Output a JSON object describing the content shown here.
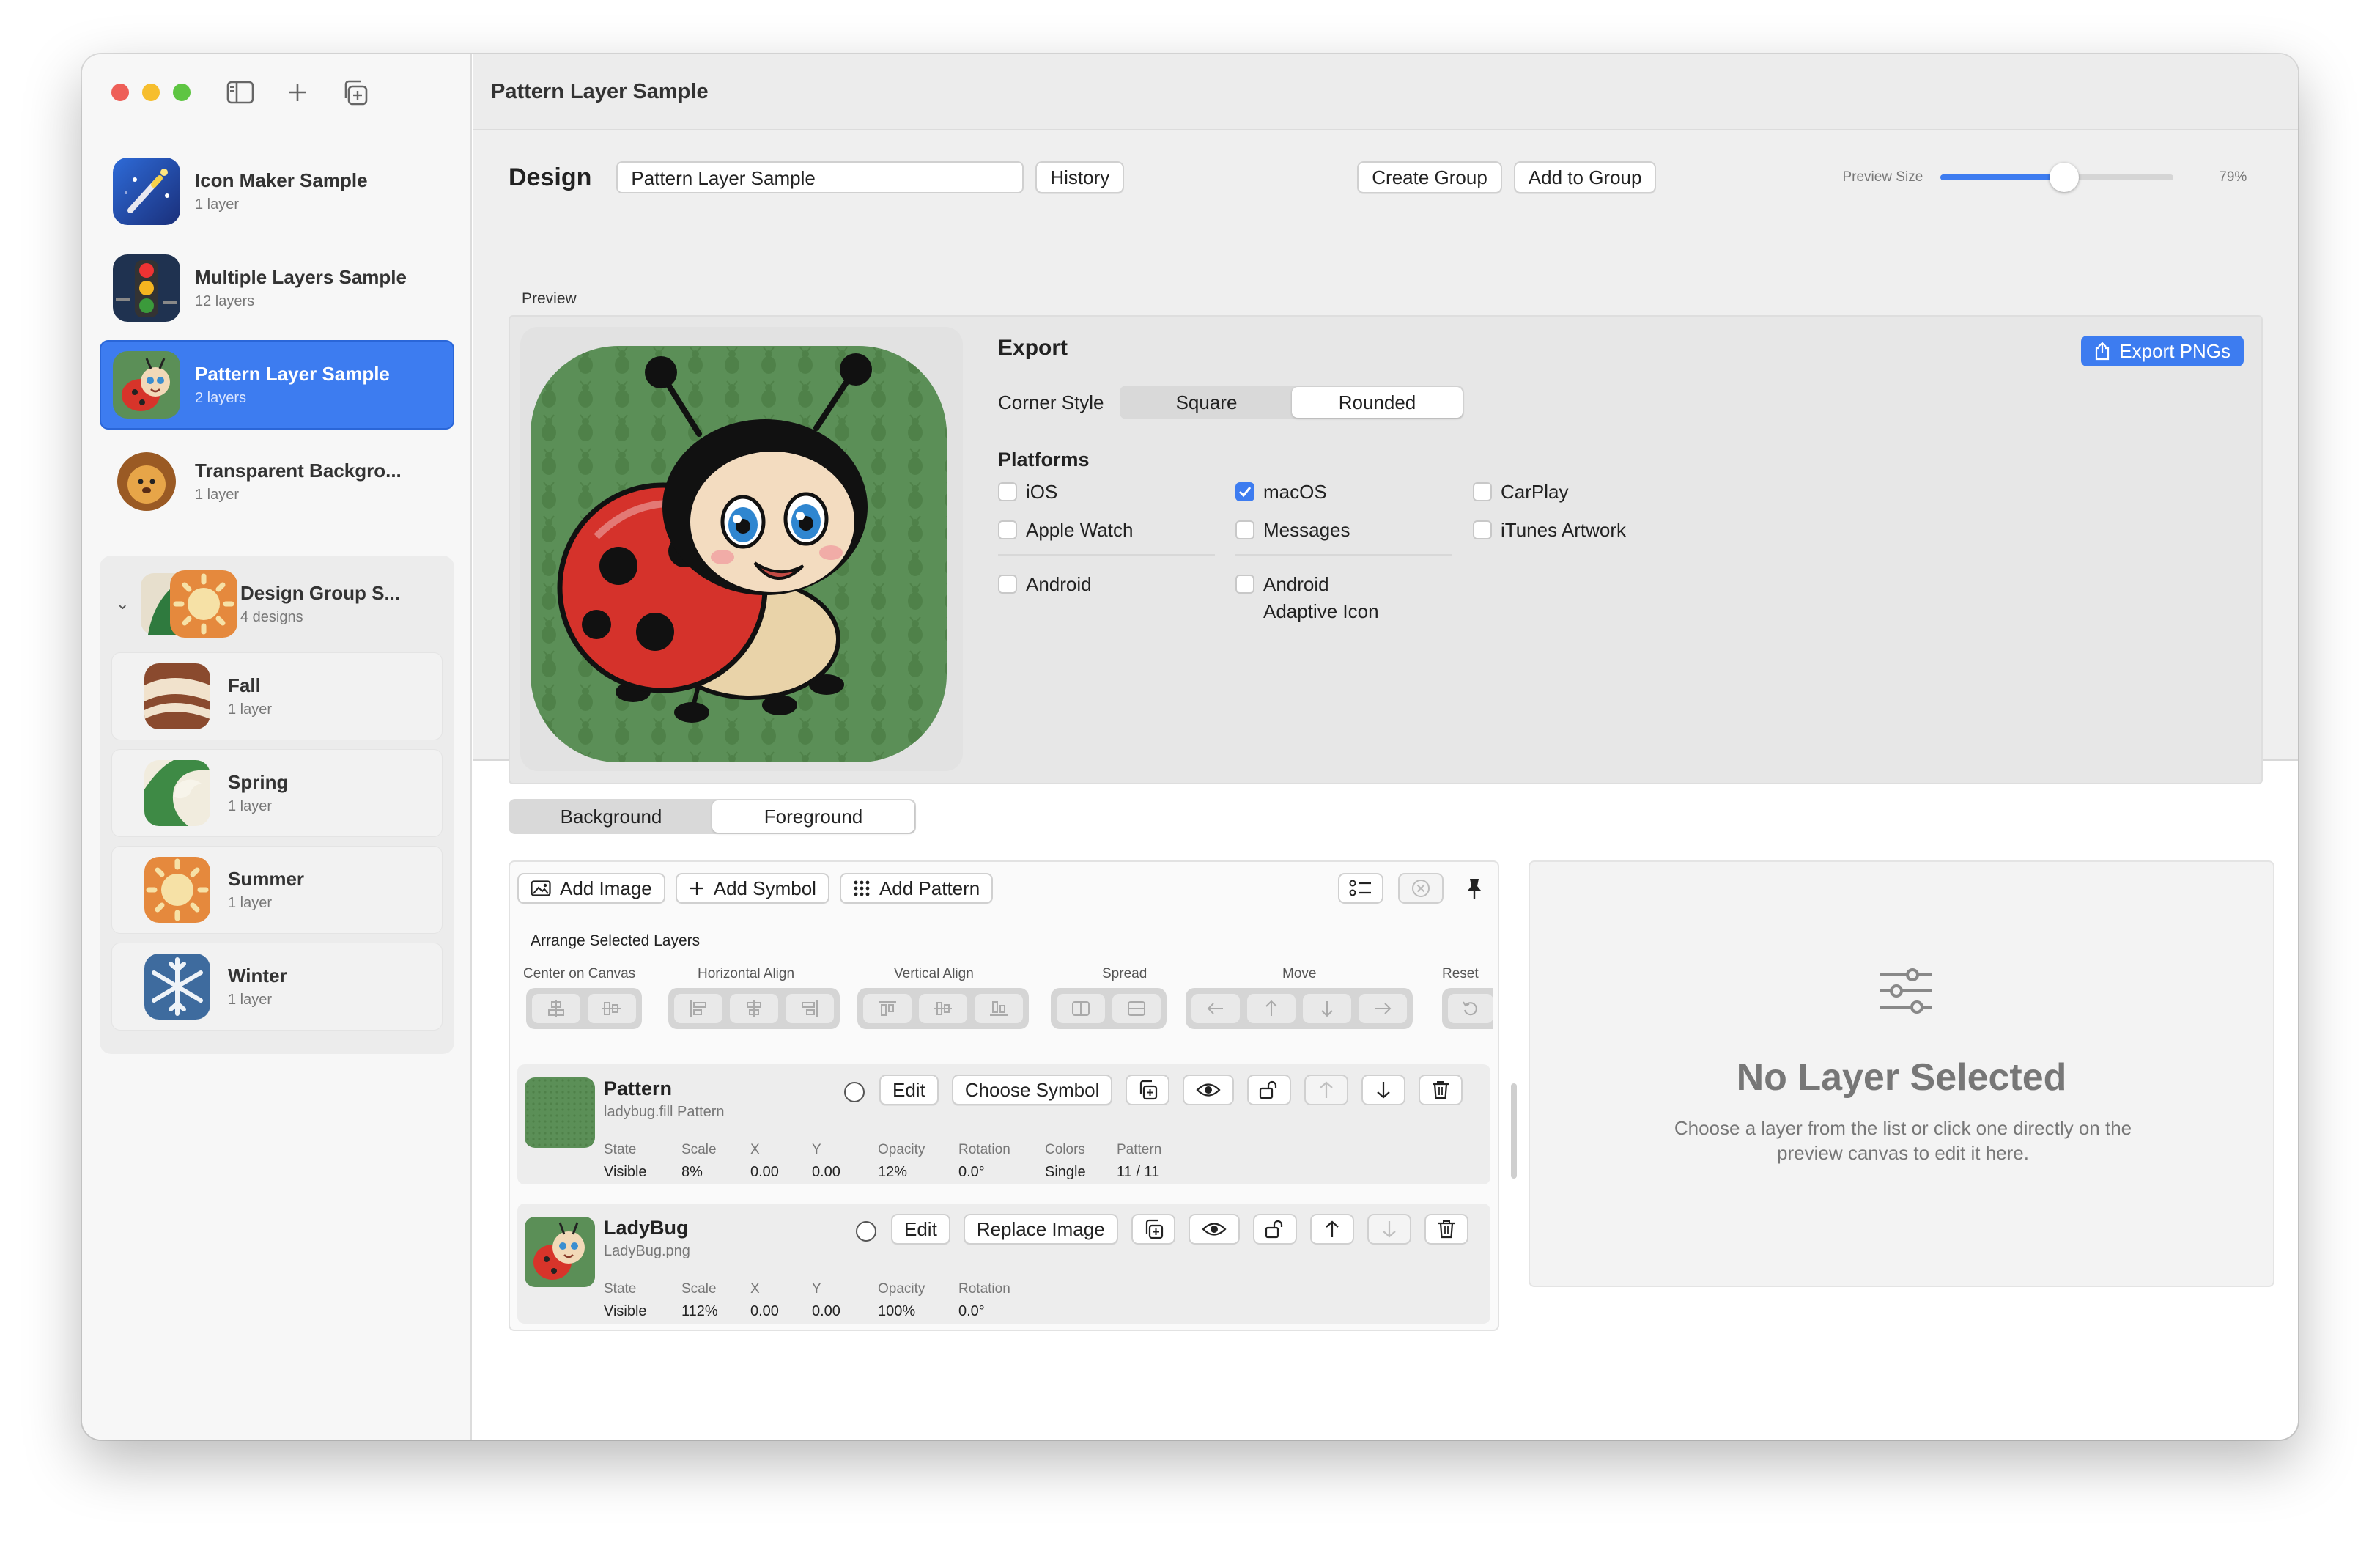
{
  "window": {
    "title": "Pattern Layer Sample"
  },
  "sidebar": {
    "documents": [
      {
        "title": "Icon Maker Sample",
        "subtitle": "1 layer"
      },
      {
        "title": "Multiple Layers Sample",
        "subtitle": "12 layers"
      },
      {
        "title": "Pattern Layer Sample",
        "subtitle": "2 layers",
        "selected": true
      },
      {
        "title": "Transparent Backgro...",
        "subtitle": "1 layer"
      }
    ],
    "group": {
      "title": "Design Group S...",
      "subtitle": "4 designs",
      "items": [
        {
          "title": "Fall",
          "subtitle": "1 layer"
        },
        {
          "title": "Spring",
          "subtitle": "1 layer"
        },
        {
          "title": "Summer",
          "subtitle": "1 layer"
        },
        {
          "title": "Winter",
          "subtitle": "1 layer"
        }
      ]
    }
  },
  "design": {
    "label": "Design",
    "name_value": "Pattern Layer Sample",
    "history_label": "History",
    "create_group_label": "Create Group",
    "add_to_group_label": "Add to Group",
    "preview_size_label": "Preview Size",
    "preview_size_value": "79%",
    "preview_size_fraction": 0.53
  },
  "preview": {
    "label": "Preview"
  },
  "export": {
    "heading": "Export",
    "export_button": "Export PNGs",
    "corner_style_label": "Corner Style",
    "corner_options": [
      "Square",
      "Rounded"
    ],
    "corner_selected": "Rounded",
    "platforms_heading": "Platforms",
    "platforms": [
      {
        "label": "iOS",
        "checked": false
      },
      {
        "label": "macOS",
        "checked": true
      },
      {
        "label": "CarPlay",
        "checked": false
      },
      {
        "label": "Apple Watch",
        "checked": false
      },
      {
        "label": "Messages",
        "checked": false
      },
      {
        "label": "iTunes Artwork",
        "checked": false
      },
      {
        "label": "Android",
        "checked": false
      },
      {
        "label": "Android",
        "label2": "Adaptive Icon",
        "checked": false
      }
    ]
  },
  "layer_tabs": {
    "options": [
      "Background",
      "Foreground"
    ],
    "selected": "Foreground"
  },
  "layers_toolbar": {
    "add_image": "Add Image",
    "add_symbol": "Add Symbol",
    "add_pattern": "Add Pattern"
  },
  "arrange": {
    "heading": "Arrange Selected Layers",
    "groups": [
      "Center on Canvas",
      "Horizontal Align",
      "Vertical Align",
      "Spread",
      "Move",
      "Reset"
    ]
  },
  "layers": [
    {
      "name": "Pattern",
      "subtitle": "ladybug.fill Pattern",
      "edit_label": "Edit",
      "choose_label": "Choose Symbol",
      "stats": [
        {
          "k": "State",
          "v": "Visible"
        },
        {
          "k": "Scale",
          "v": "8%"
        },
        {
          "k": "X",
          "v": "0.00"
        },
        {
          "k": "Y",
          "v": "0.00"
        },
        {
          "k": "Opacity",
          "v": "12%"
        },
        {
          "k": "Rotation",
          "v": "0.0°"
        },
        {
          "k": "Colors",
          "v": "Single"
        },
        {
          "k": "Pattern",
          "v": "11 / 11"
        }
      ]
    },
    {
      "name": "LadyBug",
      "subtitle": "LadyBug.png",
      "edit_label": "Edit",
      "choose_label": "Replace Image",
      "stats": [
        {
          "k": "State",
          "v": "Visible"
        },
        {
          "k": "Scale",
          "v": "112%"
        },
        {
          "k": "X",
          "v": "0.00"
        },
        {
          "k": "Y",
          "v": "0.00"
        },
        {
          "k": "Opacity",
          "v": "100%"
        },
        {
          "k": "Rotation",
          "v": "0.0°"
        }
      ]
    }
  ],
  "no_selection": {
    "heading": "No Layer Selected",
    "body": "Choose a layer from the list or click one directly on the preview canvas to edit it here."
  },
  "colors": {
    "accent": "#3d7cf0",
    "pattern_green": "#5b8f57",
    "traffic_red": "#ee5f58",
    "traffic_yellow": "#f6be2e",
    "traffic_green": "#5ec542"
  }
}
